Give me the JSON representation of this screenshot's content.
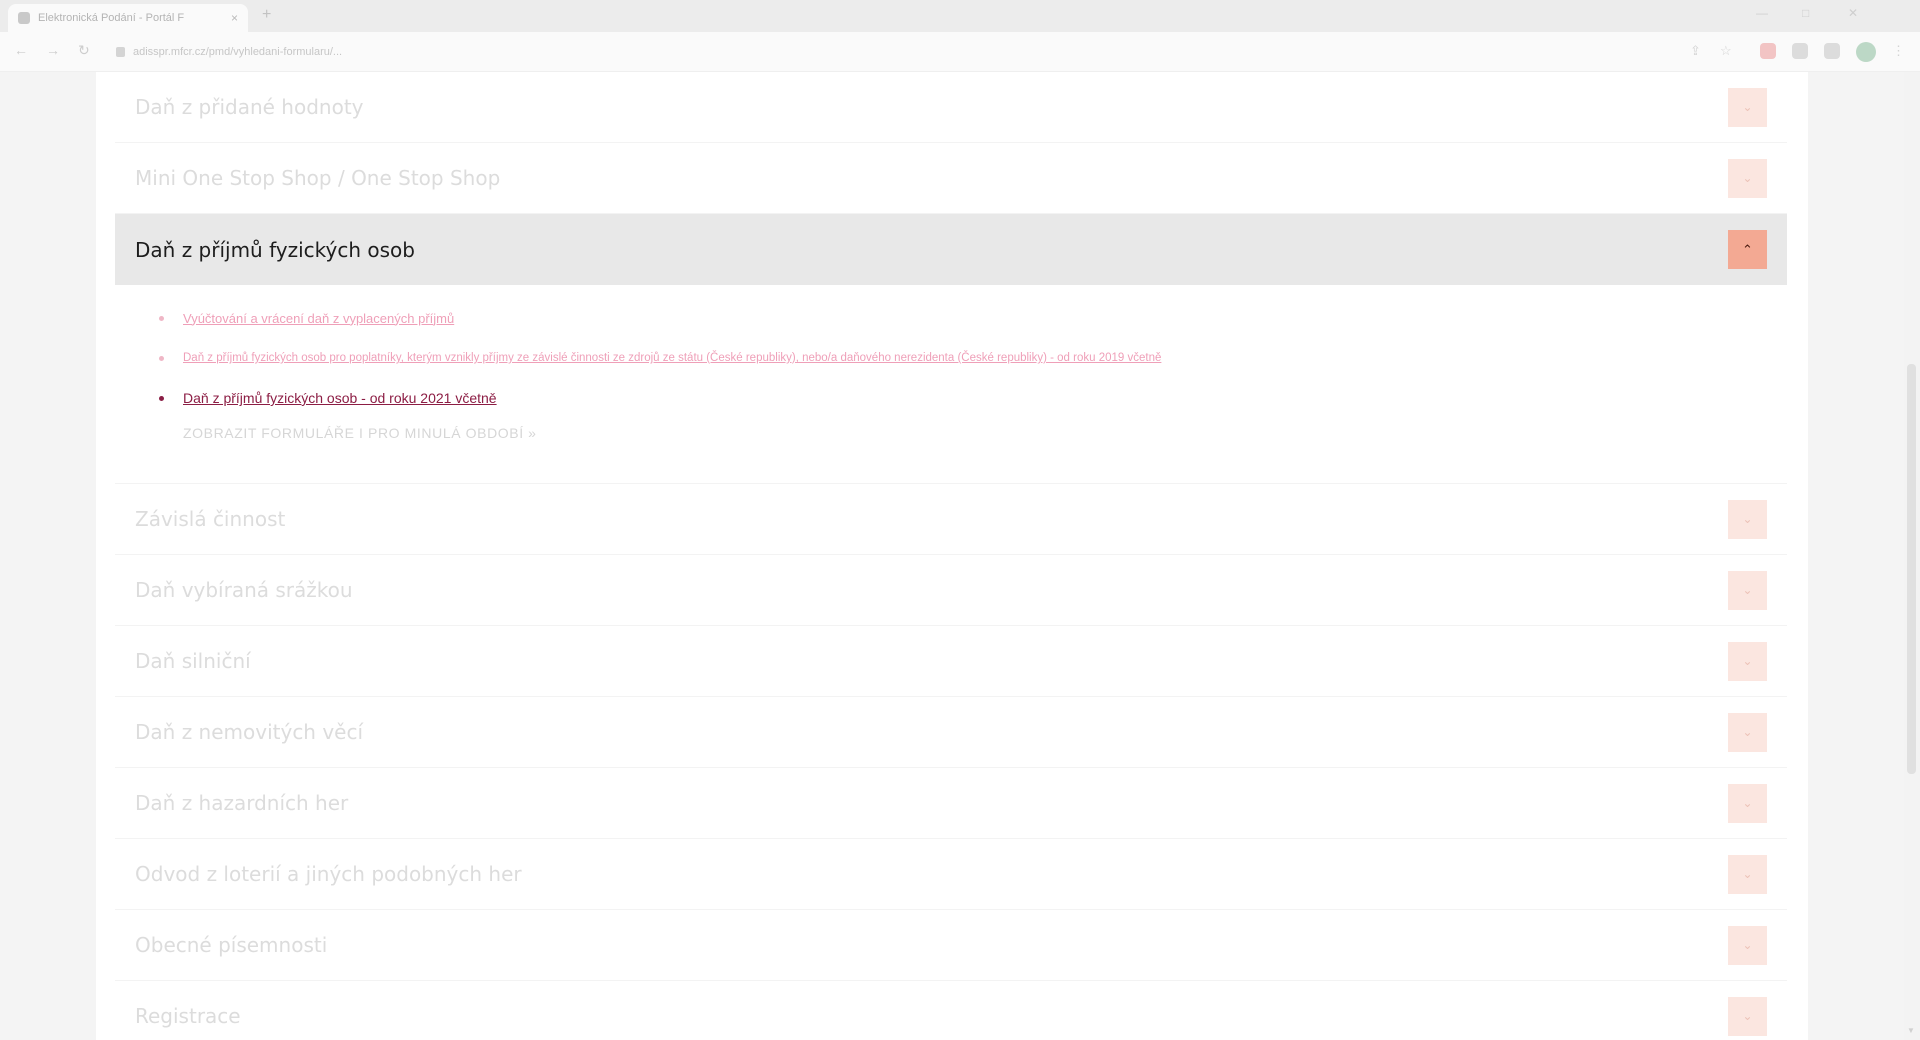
{
  "browser": {
    "tab_title": "Elektronická Podání - Portál F",
    "tab_close": "×",
    "new_tab": "+",
    "url": "adisspr.mfcr.cz/pmd/vyhledani-formularu/...",
    "nav": {
      "back": "←",
      "forward": "→",
      "reload": "↻"
    },
    "window": {
      "minimize": "—",
      "maximize": "□",
      "close": "✕"
    }
  },
  "accordion": {
    "items_before": [
      {
        "title": "Daň z přidané hodnoty",
        "toggle": "⌄"
      },
      {
        "title": "Mini One Stop Shop / One Stop Shop",
        "toggle": "⌄"
      }
    ],
    "open_item": {
      "title": "Daň z příjmů fyzických osob",
      "toggle": "⌃",
      "links": [
        "Vyúčtování a vrácení daň z vyplacených příjmů",
        "Daň z příjmů fyzických osob pro poplatníky, kterým vznikly příjmy ze závislé činnosti ze zdrojů ze státu (České republiky), nebo/a daňového nerezidenta (České republiky) - od roku 2019 včetně",
        "Daň z příjmů fyzických osob - od roku 2021 včetně"
      ],
      "show_forms": "ZOBRAZIT FORMULÁŘE I PRO MINULÁ OBDOBÍ »"
    },
    "items_after": [
      {
        "title": "Závislá činnost",
        "toggle": "⌄"
      },
      {
        "title": "Daň vybíraná srážkou",
        "toggle": "⌄"
      },
      {
        "title": "Daň silniční",
        "toggle": "⌄"
      },
      {
        "title": "Daň z nemovitých věcí",
        "toggle": "⌄"
      },
      {
        "title": "Daň z hazardních her",
        "toggle": "⌄"
      },
      {
        "title": "Odvod z loterií a jiných podobných her",
        "toggle": "⌄"
      },
      {
        "title": "Obecné písemnosti",
        "toggle": "⌄"
      },
      {
        "title": "Registrace",
        "toggle": "⌄"
      }
    ]
  },
  "colors": {
    "accent": "#8c1d44",
    "toggle_active": "#f3a993",
    "open_header_bg": "#e8e8e8"
  }
}
